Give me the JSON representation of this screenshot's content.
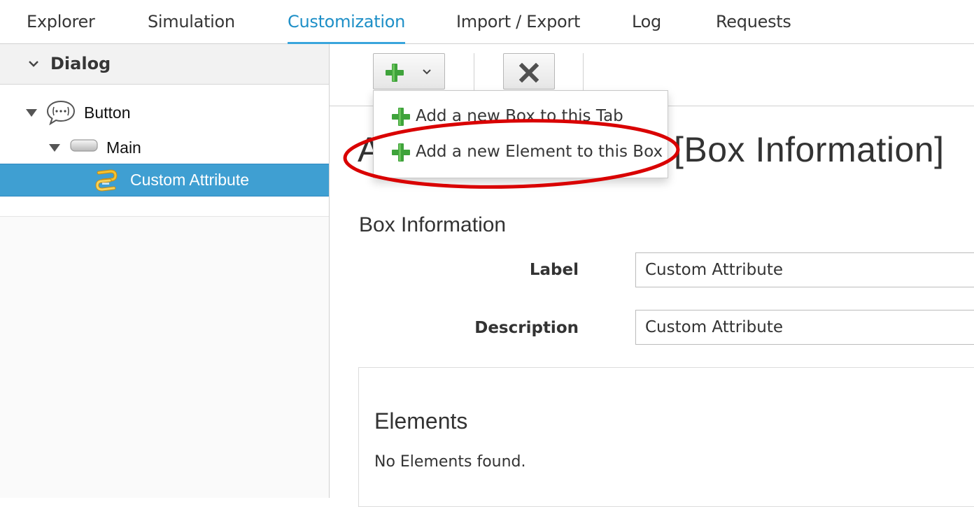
{
  "tabs": [
    {
      "label": "Explorer"
    },
    {
      "label": "Simulation"
    },
    {
      "label": "Customization",
      "active": true
    },
    {
      "label": "Import / Export"
    },
    {
      "label": "Log"
    },
    {
      "label": "Requests"
    }
  ],
  "sidebar": {
    "header": "Dialog",
    "tree": {
      "root": {
        "label": "Button",
        "icon": "speech-bubble-icon"
      },
      "child": {
        "label": "Main",
        "icon": "button-shape-icon"
      },
      "leaf": {
        "label": "Custom Attribute",
        "icon": "chain-link-icon",
        "selected": true
      }
    }
  },
  "toolbar": {
    "add_button_icon": "plus-icon",
    "delete_button_icon": "x-icon"
  },
  "dropdown": {
    "items": [
      {
        "label": "Add a new Box to this Tab"
      },
      {
        "label": "Add a new Element to this Box"
      }
    ]
  },
  "page": {
    "title_prefix": "A",
    "title_suffix": "[Box Information]"
  },
  "form": {
    "section_title": "Box Information",
    "label_field_label": "Label",
    "label_field_value": "Custom Attribute",
    "description_field_label": "Description",
    "description_field_value": "Custom Attribute"
  },
  "elements_panel": {
    "title": "Elements",
    "empty_text": "No Elements found."
  },
  "colors": {
    "accent": "#39a5dc",
    "selected_row": "#3f9fd2",
    "plus_green": "#3fa33b",
    "annotation_red": "#d90000"
  }
}
